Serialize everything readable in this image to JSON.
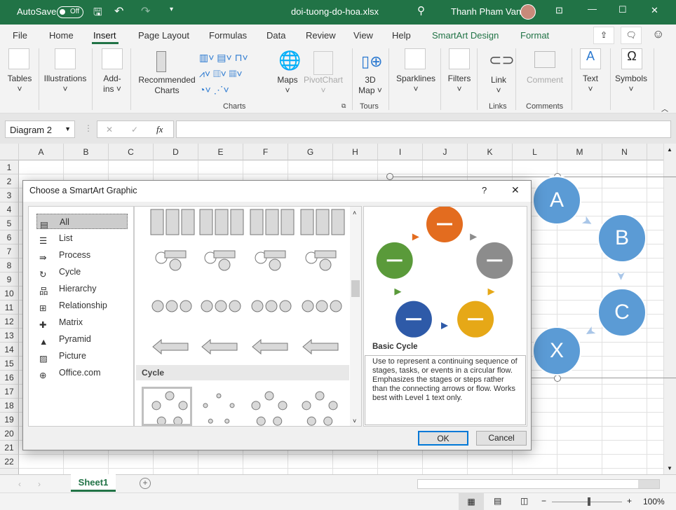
{
  "titlebar": {
    "autosave_label": "AutoSave",
    "autosave_state": "Off",
    "filename": "doi-tuong-do-hoa.xlsx",
    "user": "Thanh Pham Van",
    "color": "#217346"
  },
  "tabs": [
    "File",
    "Home",
    "Insert",
    "Page Layout",
    "Formulas",
    "Data",
    "Review",
    "View",
    "Help",
    "SmartArt Design",
    "Format"
  ],
  "active_tab": "Insert",
  "ribbon": {
    "tables": "Tables",
    "illustrations": "Illustrations",
    "addins_1": "Add-",
    "addins_2": "ins",
    "recommended_1": "Recommended",
    "recommended_2": "Charts",
    "maps": "Maps",
    "pivotchart": "PivotChart",
    "map3d_1": "3D",
    "map3d_2": "Map",
    "sparklines": "Sparklines",
    "filters": "Filters",
    "link": "Link",
    "comment": "Comment",
    "text": "Text",
    "symbols": "Symbols",
    "groups": {
      "charts": "Charts",
      "tours": "Tours",
      "links": "Links",
      "comments": "Comments"
    }
  },
  "formula_bar": {
    "name_box": "Diagram 2",
    "cancel": "✕",
    "enter": "✓",
    "fx": "fx",
    "value": ""
  },
  "columns": [
    "A",
    "B",
    "C",
    "D",
    "E",
    "F",
    "G",
    "H",
    "I",
    "J",
    "K",
    "L",
    "M",
    "N"
  ],
  "rows": [
    "1",
    "2",
    "3",
    "4",
    "5",
    "6",
    "7",
    "8",
    "9",
    "10",
    "11",
    "12",
    "13",
    "14",
    "15",
    "16",
    "17",
    "18",
    "19",
    "20",
    "21",
    "22"
  ],
  "smartart": {
    "nodes": [
      "A",
      "B",
      "C",
      "X"
    ],
    "color": "#5b9bd5"
  },
  "dialog": {
    "title": "Choose a SmartArt Graphic",
    "help": "?",
    "close": "✕",
    "categories": [
      "All",
      "List",
      "Process",
      "Cycle",
      "Hierarchy",
      "Relationship",
      "Matrix",
      "Pyramid",
      "Picture",
      "Office.com"
    ],
    "selected_category": "All",
    "gallery_section": "Cycle",
    "preview": {
      "name": "Basic Cycle",
      "description": "Use to represent a continuing sequence of stages, tasks, or events in a circular flow. Emphasizes the stages or steps rather than the connecting arrows or flow. Works best with Level 1 text only.",
      "node_colors": [
        "#e36c1f",
        "#8c8c8c",
        "#e6a817",
        "#2e5aa8",
        "#5a9a3a"
      ]
    },
    "ok": "OK",
    "cancel": "Cancel"
  },
  "sheet_tabs": {
    "active": "Sheet1",
    "add": "+"
  },
  "status": {
    "zoom": "100%",
    "minus": "−",
    "plus": "+"
  }
}
